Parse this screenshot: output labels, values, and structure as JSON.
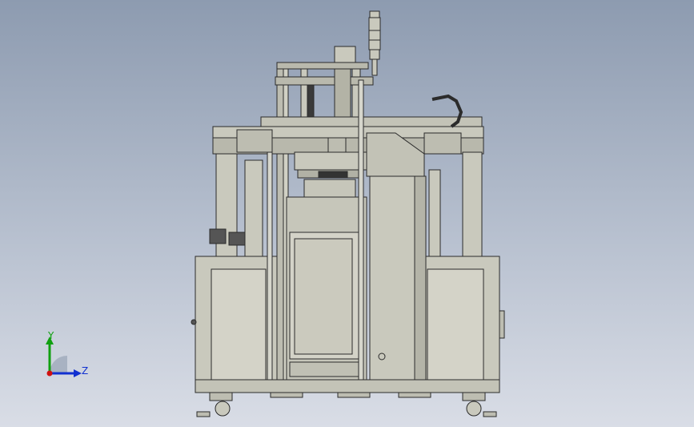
{
  "viewport": {
    "background_top": "#8d9bb0",
    "background_bottom": "#d9dde6"
  },
  "model": {
    "body_color": "#c9c9bd",
    "edge_color": "#2b2b2b",
    "panel_color": "#d4d3c8"
  },
  "triad": {
    "y_label": "Y",
    "z_label": "Z",
    "y_color": "#10a010",
    "z_color": "#1030d0",
    "x_color": "#d01010"
  }
}
